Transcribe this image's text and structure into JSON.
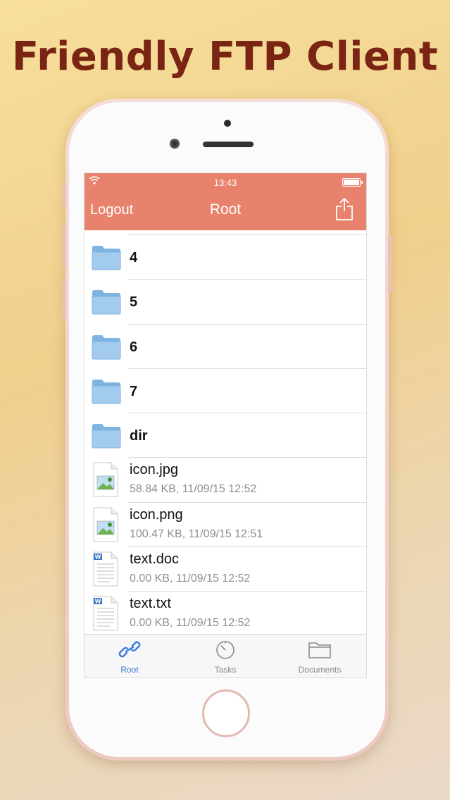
{
  "headline": "Friendly FTP Client",
  "status_bar": {
    "time": "13:43"
  },
  "navbar": {
    "left_label": "Logout",
    "title": "Root"
  },
  "files": [
    {
      "name": "4",
      "type": "folder"
    },
    {
      "name": "5",
      "type": "folder"
    },
    {
      "name": "6",
      "type": "folder"
    },
    {
      "name": "7",
      "type": "folder"
    },
    {
      "name": "dir",
      "type": "folder"
    },
    {
      "name": "icon.jpg",
      "type": "image",
      "meta": "58.84 KB, 11/09/15 12:52"
    },
    {
      "name": "icon.png",
      "type": "image",
      "meta": "100.47 KB, 11/09/15 12:51"
    },
    {
      "name": "text.doc",
      "type": "doc",
      "meta": "0.00 KB, 11/09/15 12:52"
    },
    {
      "name": "text.txt",
      "type": "doc",
      "meta": "0.00 KB, 11/09/15 12:52"
    }
  ],
  "tabs": [
    {
      "label": "Root",
      "icon": "link-icon",
      "active": true
    },
    {
      "label": "Tasks",
      "icon": "timer-icon",
      "active": false
    },
    {
      "label": "Documents",
      "icon": "folder-outline-icon",
      "active": false
    }
  ],
  "colors": {
    "navbar": "#e9826c",
    "headline": "#7a2413",
    "tab_active": "#3a7ad9",
    "tab_inactive": "#8a8a8a"
  }
}
